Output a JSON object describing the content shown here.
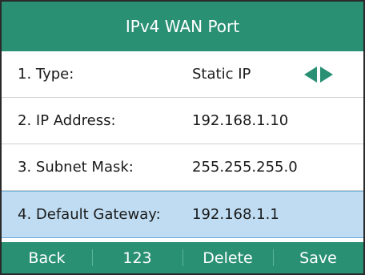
{
  "header": {
    "title": "IPv4 WAN Port"
  },
  "rows": [
    {
      "label": "1. Type:",
      "value": "Static IP"
    },
    {
      "label": "2. IP Address:",
      "value": "192.168.1.10"
    },
    {
      "label": "3. Subnet Mask:",
      "value": "255.255.255.0"
    },
    {
      "label": "4. Default Gateway:",
      "value": "192.168.1.1"
    }
  ],
  "selected_row": 4,
  "softkeys": [
    "Back",
    "123",
    "Delete",
    "Save"
  ],
  "icons": {
    "left": "left-arrow-icon",
    "right": "right-arrow-icon"
  },
  "colors": {
    "accent": "#2a9074",
    "selected_row": "#bfdcf2"
  }
}
